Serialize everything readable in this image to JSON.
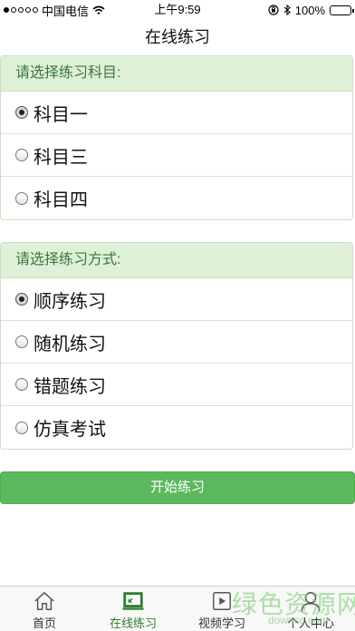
{
  "status_bar": {
    "carrier": "中国电信",
    "time": "上午9:59",
    "battery": "100%"
  },
  "nav": {
    "title": "在线练习"
  },
  "subject_section": {
    "header": "请选择练习科目:",
    "options": [
      {
        "label": "科目一",
        "checked": true
      },
      {
        "label": "科目三",
        "checked": false
      },
      {
        "label": "科目四",
        "checked": false
      }
    ]
  },
  "mode_section": {
    "header": "请选择练习方式:",
    "options": [
      {
        "label": "顺序练习",
        "checked": true
      },
      {
        "label": "随机练习",
        "checked": false
      },
      {
        "label": "错题练习",
        "checked": false
      },
      {
        "label": "仿真考试",
        "checked": false
      }
    ]
  },
  "start_button": {
    "label": "开始练习"
  },
  "tab_bar": {
    "items": [
      {
        "label": "首页",
        "icon": "home-icon",
        "active": false
      },
      {
        "label": "在线练习",
        "icon": "practice-icon",
        "active": true
      },
      {
        "label": "视频学习",
        "icon": "video-icon",
        "active": false
      },
      {
        "label": "个人中心",
        "icon": "person-icon",
        "active": false
      }
    ]
  },
  "watermark": {
    "text": "绿色资源网",
    "sub": "downcc.com"
  },
  "colors": {
    "accent_green": "#5cb85c",
    "header_bg": "#dff0d8",
    "header_text": "#3c763d"
  }
}
